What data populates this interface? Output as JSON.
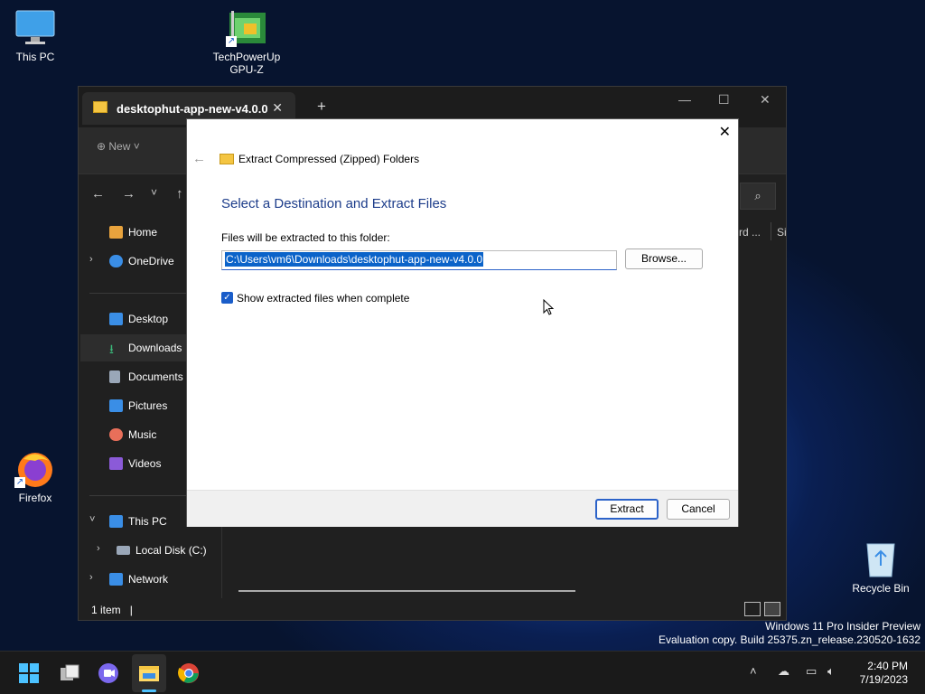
{
  "desktop": {
    "icons": [
      {
        "label": "This PC",
        "icon": "monitor-icon"
      },
      {
        "label": "TechPowerUp GPU-Z",
        "icon": "gpu-z-icon"
      },
      {
        "label": "Firefox",
        "icon": "firefox-icon"
      },
      {
        "label": "Recycle Bin",
        "icon": "recycle-bin-icon"
      }
    ]
  },
  "explorer": {
    "tab_title": "desktophut-app-new-v4.0.0",
    "new_label": "New",
    "columns": [
      "rd ...",
      "Si"
    ],
    "sidebar": [
      {
        "label": "Home",
        "icon": "home-icon",
        "color": "#e8a33d"
      },
      {
        "label": "OneDrive",
        "icon": "cloud-icon",
        "color": "#3a8ee6"
      },
      {
        "label": "Desktop",
        "icon": "desktop-icon",
        "color": "#3a8ee6"
      },
      {
        "label": "Downloads",
        "icon": "download-icon",
        "color": "#3bb87a"
      },
      {
        "label": "Documents",
        "icon": "document-icon",
        "color": "#9aa7b8"
      },
      {
        "label": "Pictures",
        "icon": "pictures-icon",
        "color": "#3a8ee6"
      },
      {
        "label": "Music",
        "icon": "music-icon",
        "color": "#e86f5a"
      },
      {
        "label": "Videos",
        "icon": "video-icon",
        "color": "#8b5ad8"
      },
      {
        "label": "This PC",
        "icon": "pc-icon",
        "color": "#3a8ee6"
      },
      {
        "label": "Local Disk (C:)",
        "icon": "disk-icon",
        "color": "#9aa7b8"
      },
      {
        "label": "Network",
        "icon": "network-icon",
        "color": "#3a8ee6"
      }
    ],
    "status": "1 item"
  },
  "dialog": {
    "header": "Extract Compressed (Zipped) Folders",
    "title": "Select a Destination and Extract Files",
    "folder_label": "Files will be extracted to this folder:",
    "folder_path": "C:\\Users\\vm6\\Downloads\\desktophut-app-new-v4.0.0",
    "browse_label": "Browse...",
    "show_files_label": "Show extracted files when complete",
    "show_files_checked": true,
    "extract_label": "Extract",
    "cancel_label": "Cancel"
  },
  "watermark": {
    "line1": "Windows 11 Pro Insider Preview",
    "line2": "Evaluation copy. Build 25375.zn_release.230520-1632"
  },
  "taskbar": {
    "time": "2:40 PM",
    "date": "7/19/2023"
  }
}
